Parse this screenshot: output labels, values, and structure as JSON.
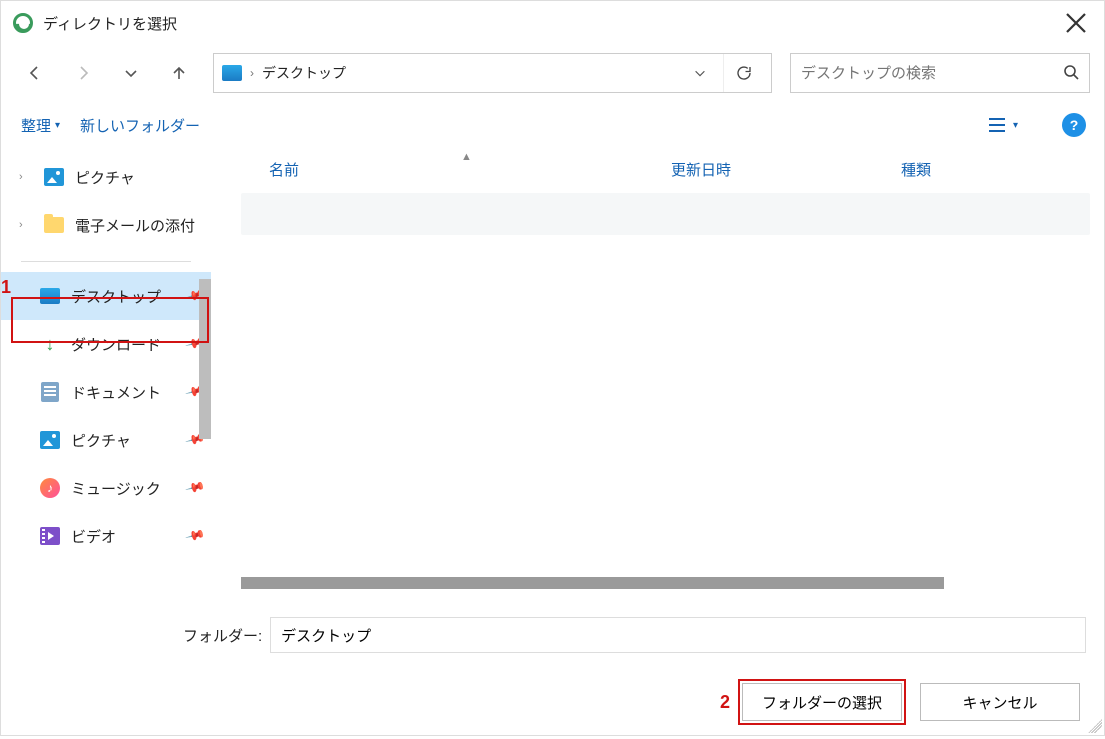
{
  "title": "ディレクトリを選択",
  "address": {
    "location": "デスクトップ"
  },
  "search": {
    "placeholder": "デスクトップの検索"
  },
  "toolbar": {
    "organize": "整理",
    "new_folder": "新しいフォルダー"
  },
  "columns": {
    "name": "名前",
    "date": "更新日時",
    "type": "種類"
  },
  "sidebar": {
    "top": [
      {
        "label": "ピクチャ"
      },
      {
        "label": "電子メールの添付"
      }
    ],
    "quick": [
      {
        "label": "デスクトップ",
        "selected": true
      },
      {
        "label": "ダウンロード"
      },
      {
        "label": "ドキュメント"
      },
      {
        "label": "ピクチャ"
      },
      {
        "label": "ミュージック"
      },
      {
        "label": "ビデオ"
      }
    ]
  },
  "folder_field": {
    "label": "フォルダー:",
    "value": "デスクトップ"
  },
  "buttons": {
    "select": "フォルダーの選択",
    "cancel": "キャンセル"
  },
  "annotations": {
    "a1": "1",
    "a2": "2"
  }
}
